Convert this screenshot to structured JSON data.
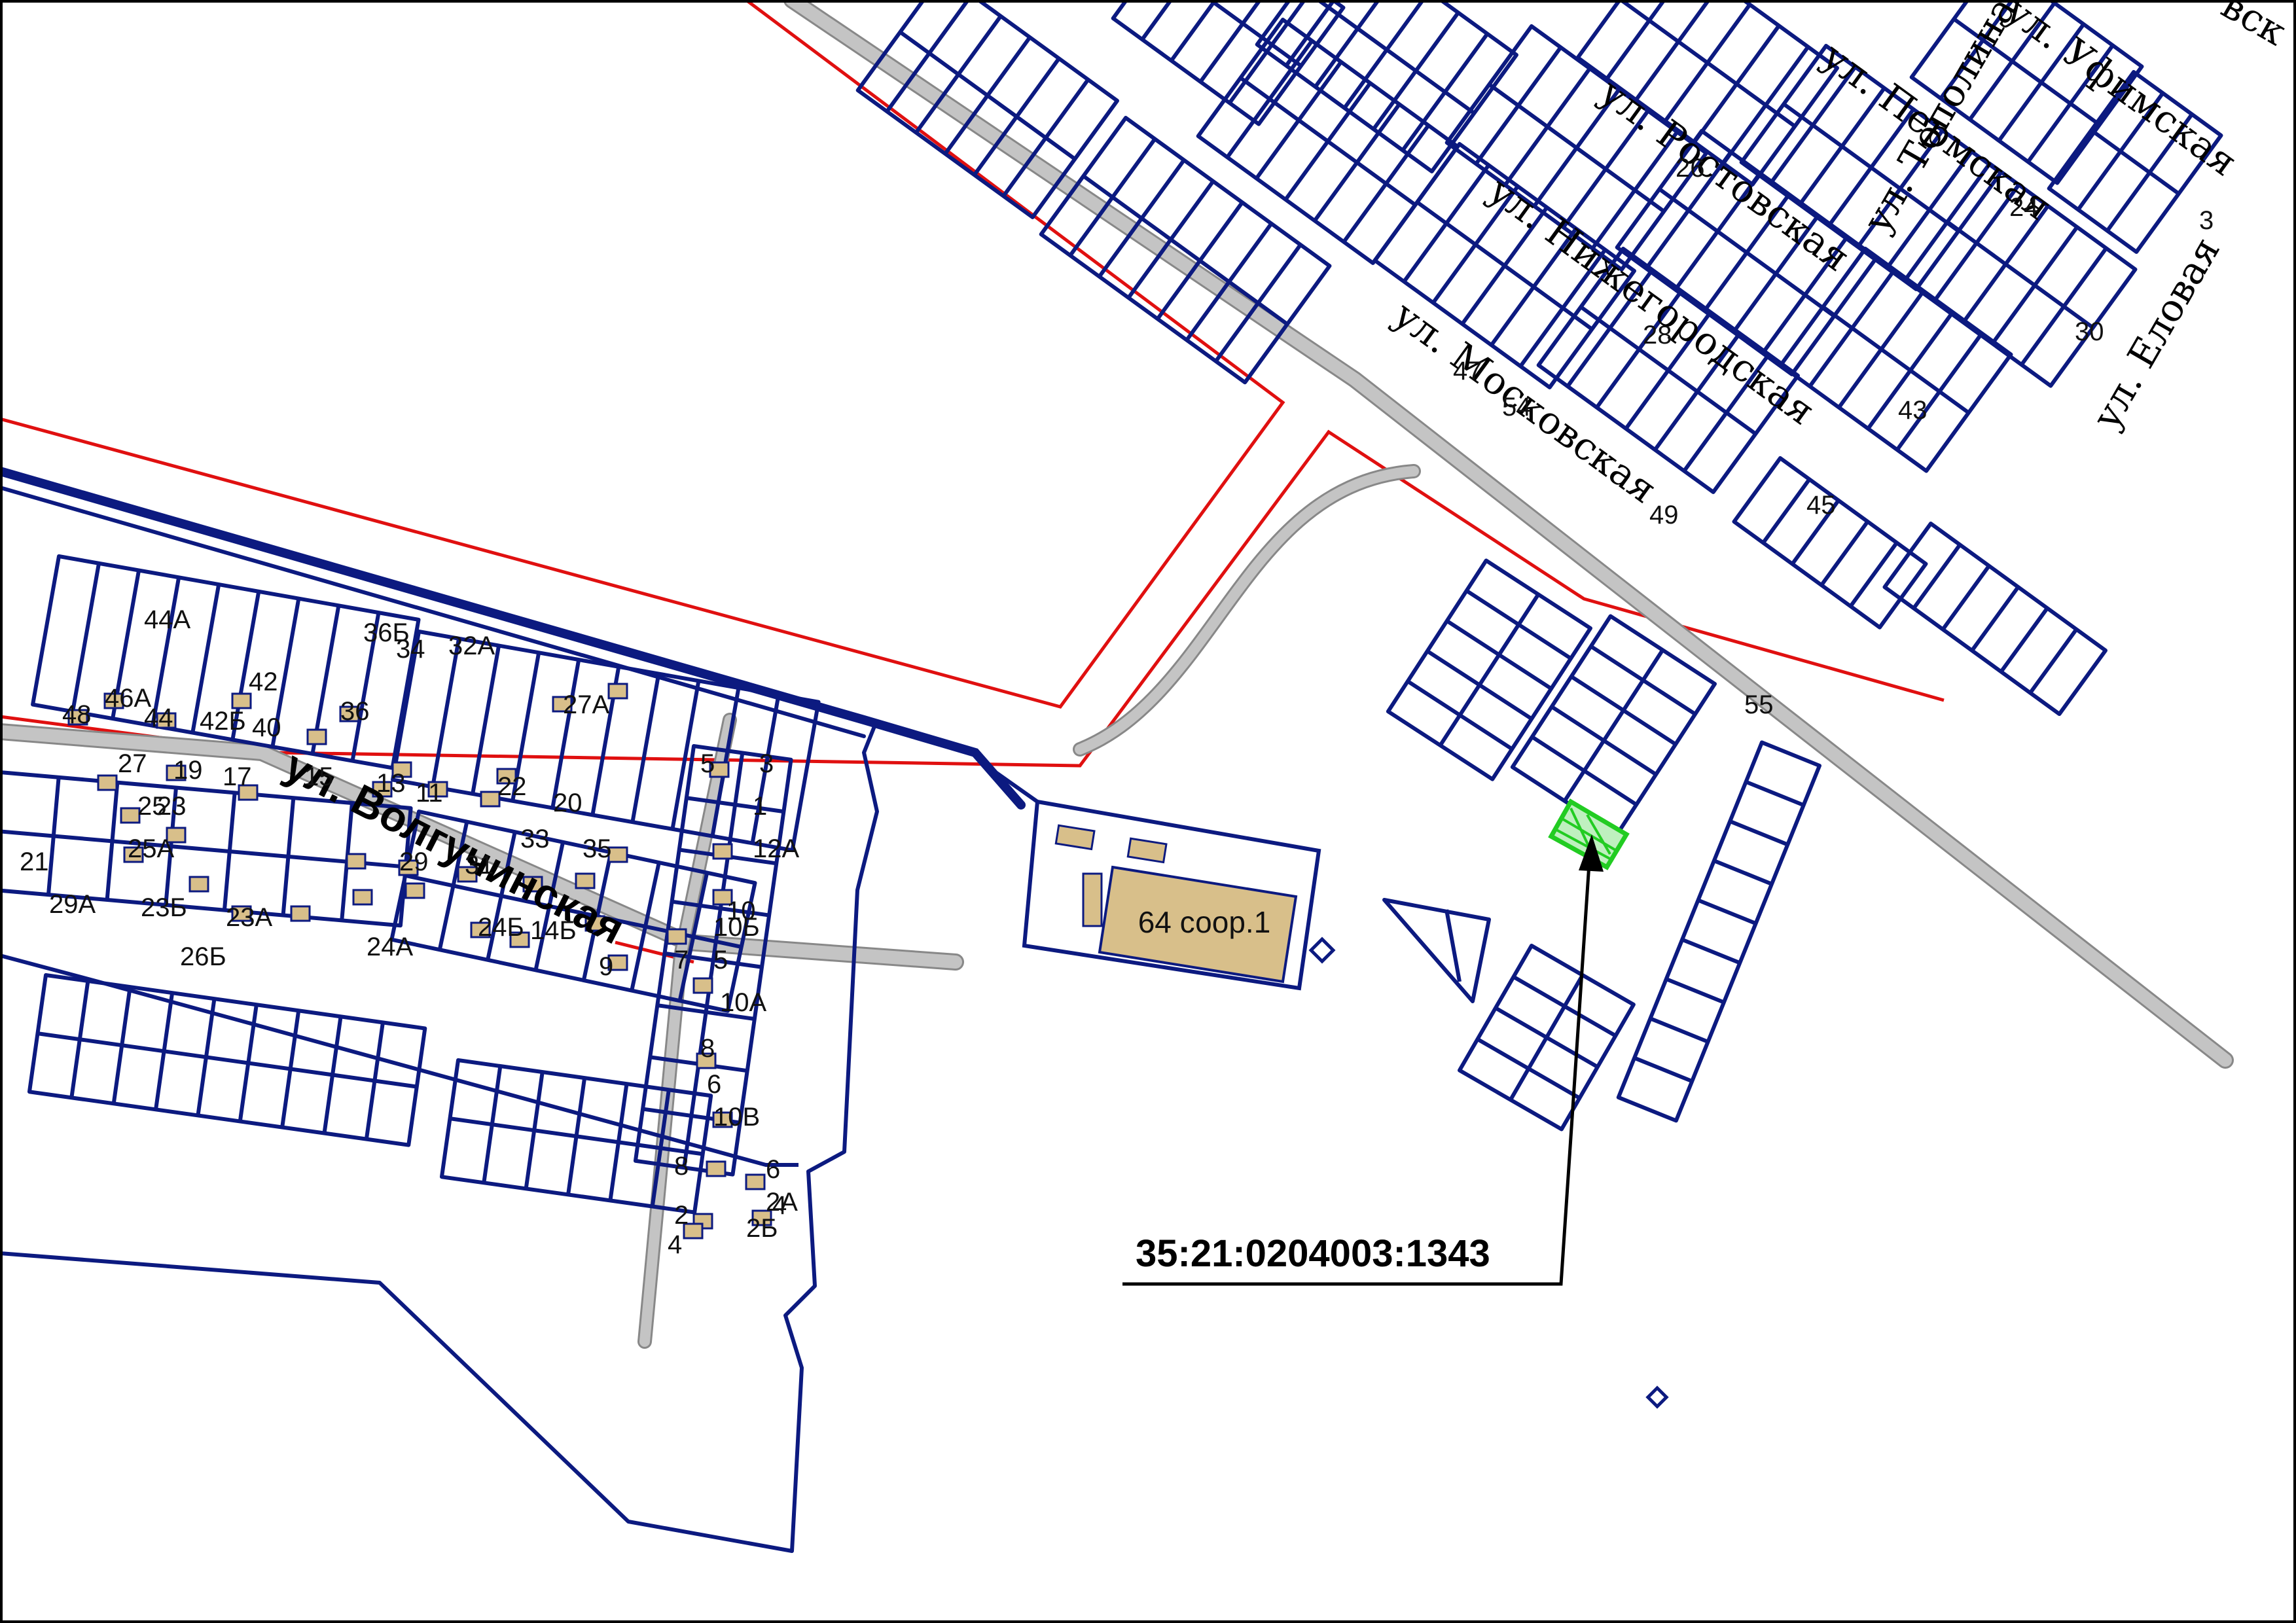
{
  "map": {
    "colors": {
      "parcel": "#0c1a80",
      "boundary": "#e01010",
      "road": "#c0c0c0",
      "road_edge": "#888888",
      "building": "#d8bf8a",
      "highlight": "#22cc22",
      "leader": "#000000"
    },
    "street_labels": [
      "ул. Волгучинская",
      "ул. Ростовская",
      "ул. Нижегородская",
      "ул. Московская",
      "ул. Уфимская",
      "ул. Пермская",
      "ул. Тополиная",
      "ул. Еловая"
    ],
    "corner_fragment": "вск",
    "facility_label": "64 соор.1",
    "cadastral_number": "35:21:0204003:1343",
    "house_numbers": [
      "44А",
      "48",
      "46А",
      "44",
      "42Б",
      "40",
      "36Б",
      "34",
      "32А",
      "42",
      "36",
      "27А",
      "27",
      "19",
      "17",
      "15",
      "13",
      "11",
      "22",
      "20",
      "25",
      "29",
      "31",
      "33",
      "35",
      "25А",
      "23",
      "21",
      "29А",
      "23Б",
      "23А",
      "26Б",
      "24А",
      "24Б",
      "14Б",
      "9",
      "7",
      "5",
      "3",
      "1",
      "12А",
      "10Б",
      "10А",
      "10В",
      "8",
      "6",
      "4",
      "2",
      "2Б",
      "2А",
      "10",
      "5",
      "8",
      "6",
      "4",
      "3",
      "24",
      "26",
      "28",
      "30",
      "43",
      "45",
      "47",
      "49",
      "54",
      "55"
    ]
  }
}
